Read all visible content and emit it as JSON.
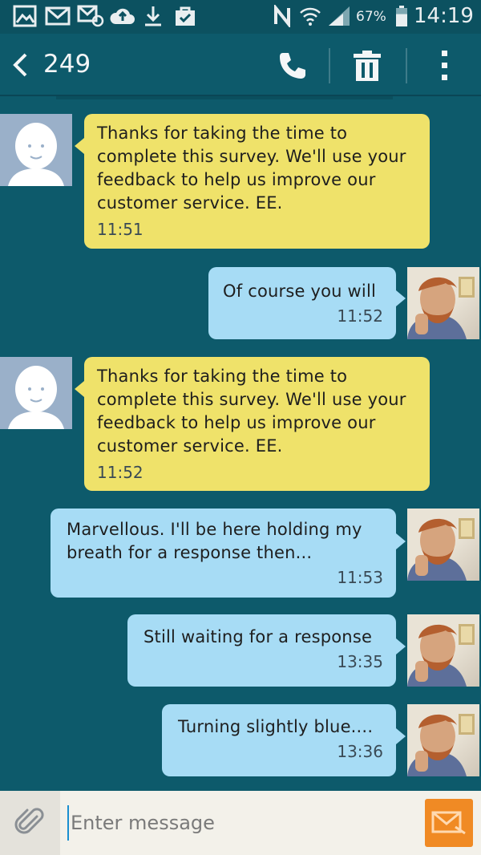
{
  "status_bar": {
    "battery_percent": "67%",
    "time": "14:19",
    "battery_level": 0.67
  },
  "header": {
    "title": "249"
  },
  "messages": [
    {
      "direction": "incoming",
      "text": "Thanks for taking the time to complete this survey. We'll use your feedback to help us improve our customer service. EE.",
      "time": "11:51"
    },
    {
      "direction": "outgoing",
      "text": "Of course you will",
      "time": "11:52"
    },
    {
      "direction": "incoming",
      "text": "Thanks for taking the time to complete this survey. We'll use your feedback to help us improve our customer service. EE.",
      "time": "11:52"
    },
    {
      "direction": "outgoing",
      "text": "Marvellous.  I'll be here holding my breath for a response then...",
      "time": "11:53"
    },
    {
      "direction": "outgoing",
      "text": "Still waiting for a response",
      "time": "13:35"
    },
    {
      "direction": "outgoing",
      "text": "Turning slightly blue....",
      "time": "13:36"
    }
  ],
  "composer": {
    "placeholder": "Enter message"
  },
  "colors": {
    "background": "#0d5a6b",
    "incoming_bubble": "#efe26a",
    "outgoing_bubble": "#a7dcf5",
    "send_button": "#f08a24"
  }
}
